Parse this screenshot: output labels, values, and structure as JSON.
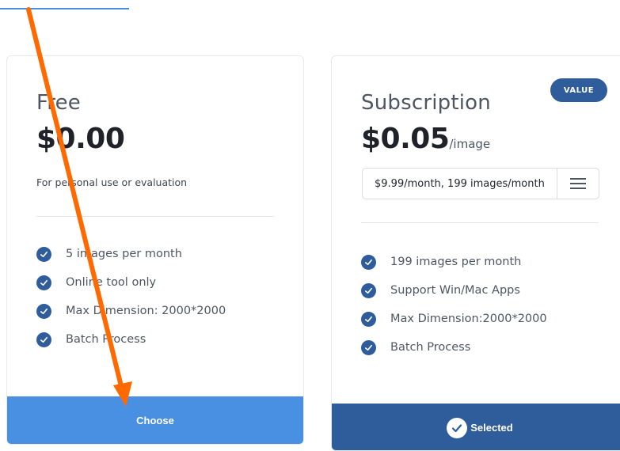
{
  "colors": {
    "accent_light": "#4a90e2",
    "accent_dark": "#2f5d9b",
    "annotation": "#ff6a00"
  },
  "plans": {
    "free": {
      "name": "Free",
      "price": "$0.00",
      "description": "For personal use or evaluation",
      "features": [
        "5 images per month",
        "Online tool only",
        "Max Dimension: 2000*2000",
        "Batch Process"
      ],
      "button_label": "Choose"
    },
    "subscription": {
      "badge": "VALUE",
      "name": "Subscription",
      "price": "$0.05",
      "price_unit": "/image",
      "option_selected": "$9.99/month, 199 images/month",
      "features": [
        "199 images per month",
        "Support Win/Mac Apps",
        "Max Dimension:2000*2000",
        "Batch Process"
      ],
      "button_label": "Selected"
    }
  },
  "icons": {
    "feature_check": "check-circle-icon",
    "selector": "menu-icon",
    "selected": "check-circle-icon",
    "annotation": "arrow-icon"
  }
}
